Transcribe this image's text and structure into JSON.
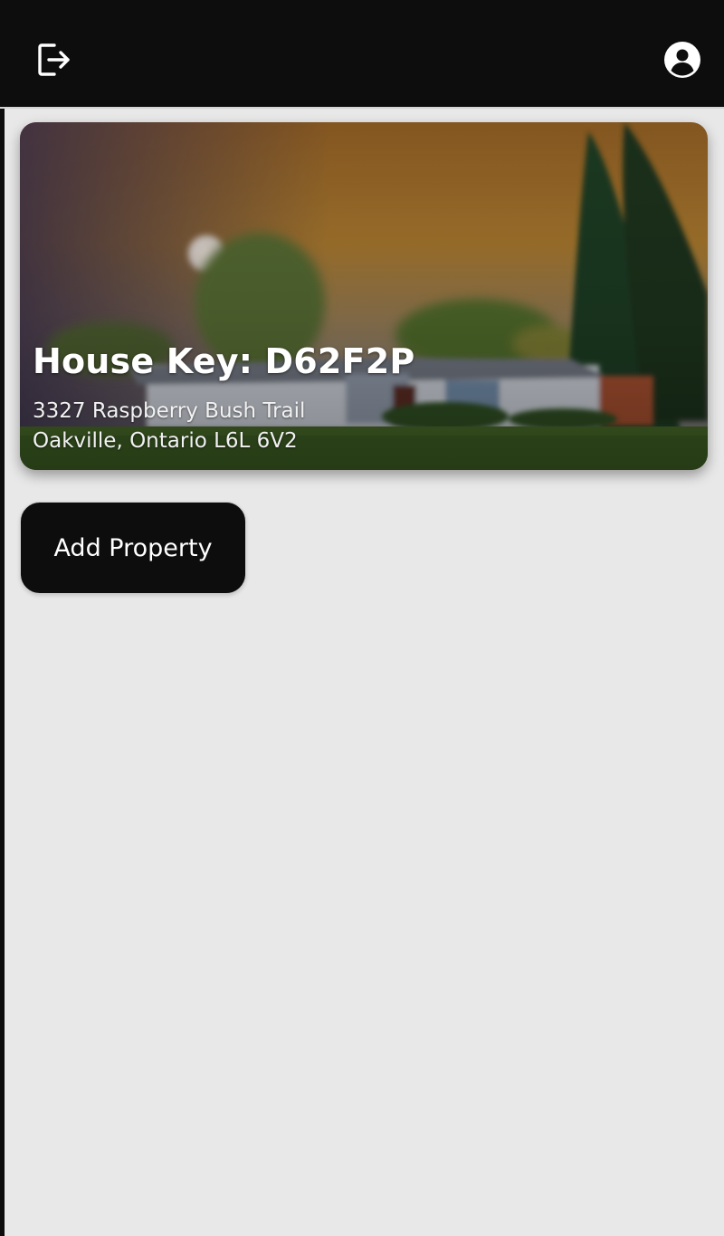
{
  "header": {
    "logout_icon": "logout-icon",
    "account_icon": "account-circle-icon"
  },
  "property_card": {
    "title": "House Key: D62F2P",
    "address_line1": "3327 Raspberry Bush Trail",
    "address_line2": "Oakville, Ontario L6L 6V2"
  },
  "actions": {
    "add_property_label": "Add Property"
  },
  "colors": {
    "topbar": "#0d0d0d",
    "background": "#e8e8e8",
    "button": "#0d0d0d",
    "text_on_dark": "#ffffff"
  }
}
